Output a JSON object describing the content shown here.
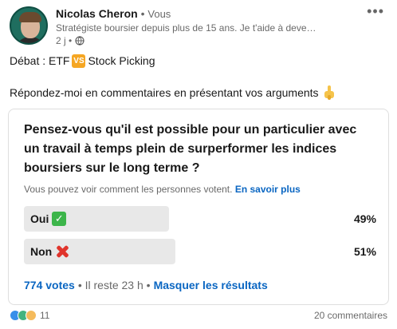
{
  "author": {
    "name": "Nicolas Cheron",
    "separator": "•",
    "relation": "Vous",
    "headline": "Stratégiste boursier depuis plus de 15 ans. Je t'aide à deve…",
    "time": "2 j •"
  },
  "icons": {
    "more": "more-horizontal-icon",
    "visibility": "globe-icon",
    "vs": "vs-emoji-icon",
    "pointing": "pointing-down-emoji-icon",
    "check": "check-mark-emoji-icon",
    "cross": "cross-mark-emoji-icon"
  },
  "post": {
    "line1_before": "Débat : ETF",
    "vs_badge": "VS",
    "line1_after": "Stock Picking",
    "line2": "Répondez-moi en commentaires en présentant vos arguments"
  },
  "poll": {
    "question": "Pensez-vous qu'il est possible pour un particulier avec un travail à temps plein de surperformer les indices boursiers sur le long terme ?",
    "notice": "Vous pouvez voir comment les personnes votent.",
    "learn_more": "En savoir plus",
    "options": [
      {
        "label": "Oui",
        "percent": "49%",
        "fraction": 0.49
      },
      {
        "label": "Non",
        "percent": "51%",
        "fraction": 0.51
      }
    ],
    "votes": "774 votes",
    "remaining": "• Il reste 23 h •",
    "hide_results": "Masquer les résultats"
  },
  "social": {
    "reactions_count": "11",
    "comments": "20 commentaires"
  },
  "colors": {
    "link": "#0a66c2",
    "bar": "#e8e8e8",
    "check": "#3cb54a",
    "cross": "#e0342c"
  }
}
